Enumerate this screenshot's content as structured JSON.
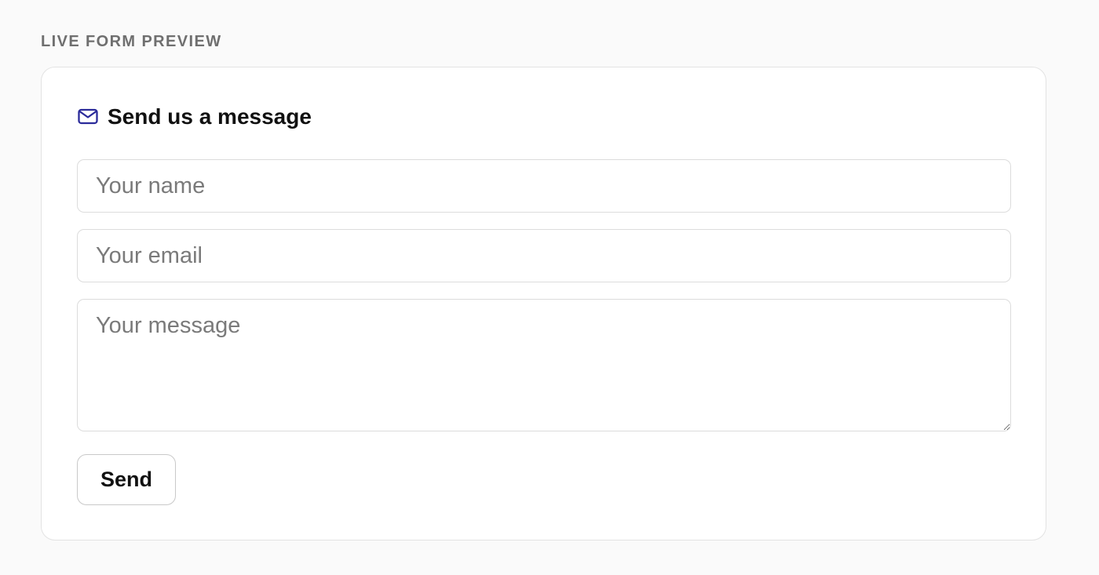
{
  "section": {
    "label": "LIVE FORM PREVIEW"
  },
  "form": {
    "icon": "mail-icon",
    "title": "Send us a message",
    "name_placeholder": "Your name",
    "email_placeholder": "Your email",
    "message_placeholder": "Your message",
    "send_label": "Send"
  },
  "colors": {
    "background": "#fafafa",
    "card": "#ffffff",
    "border": "#dcdcdc",
    "icon_accent": "#2b2b9a",
    "text_primary": "#111111",
    "text_muted": "#7a7a7a"
  }
}
